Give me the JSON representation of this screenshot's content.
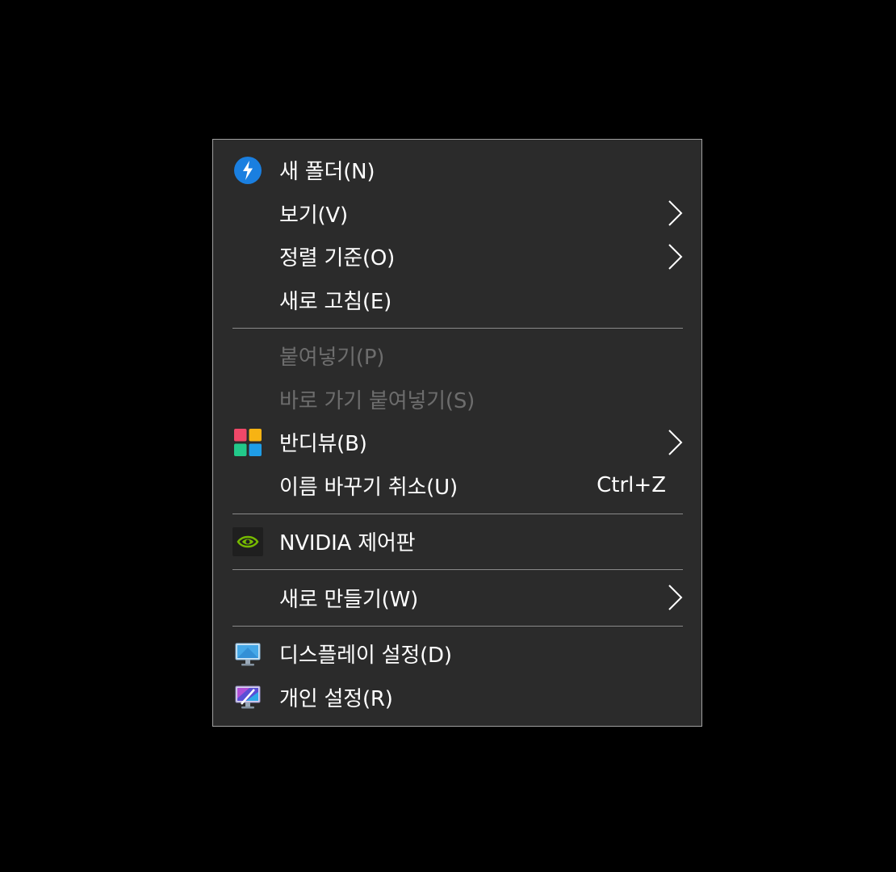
{
  "menu": {
    "new_folder": {
      "label": "새 폴더(N)",
      "icon": "blue-bolt-icon"
    },
    "view": {
      "label": "보기(V)",
      "icon": "chevron-right-icon"
    },
    "sort_by": {
      "label": "정렬 기준(O)",
      "icon": "chevron-right-icon"
    },
    "refresh": {
      "label": "새로 고침(E)"
    },
    "paste": {
      "label": "붙여넣기(P)",
      "disabled": true
    },
    "paste_shortcut": {
      "label": "바로 가기 붙여넣기(S)",
      "disabled": true
    },
    "bandiview": {
      "label": "반디뷰(B)",
      "icon": "bandiview-icon"
    },
    "undo_rename": {
      "label": "이름 바꾸기 취소(U)",
      "shortcut": "Ctrl+Z"
    },
    "nvidia": {
      "label": "NVIDIA 제어판",
      "icon": "nvidia-icon"
    },
    "new": {
      "label": "새로 만들기(W)",
      "icon": "chevron-right-icon"
    },
    "display_settings": {
      "label": "디스플레이 설정(D)",
      "icon": "display-monitor-icon"
    },
    "personalize": {
      "label": "개인 설정(R)",
      "icon": "personalize-monitor-icon"
    }
  },
  "colors": {
    "menu_bg": "#2b2b2b",
    "text": "#ffffff",
    "disabled_text": "#6d6d6d",
    "separator": "#8a8a8a"
  }
}
